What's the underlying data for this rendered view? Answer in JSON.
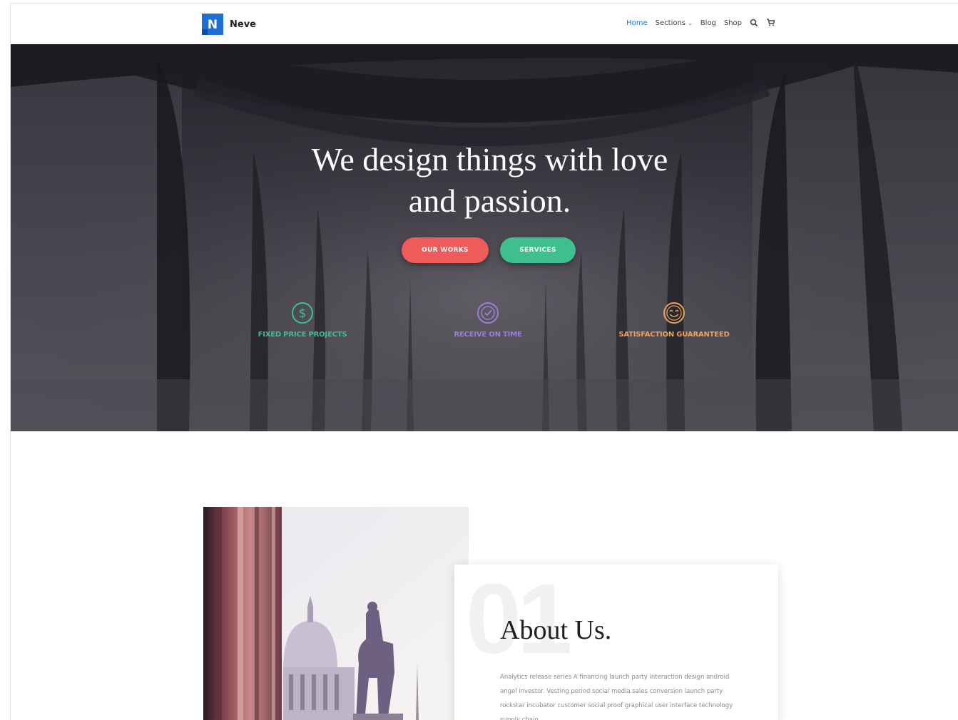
{
  "header": {
    "logo_letter": "N",
    "brand": "Neve",
    "nav": [
      {
        "label": "Home",
        "active": true
      },
      {
        "label": "Sections",
        "dropdown": true
      },
      {
        "label": "Blog"
      },
      {
        "label": "Shop"
      }
    ],
    "icons": [
      "search-icon",
      "cart-icon"
    ]
  },
  "hero": {
    "title_line1": "We design things with love",
    "title_line2": "and passion.",
    "buttons": {
      "primary": "OUR WORKS",
      "secondary": "SERVICES"
    },
    "features": [
      {
        "icon": "dollar-icon",
        "label": "FIXED PRICE PROJECTS",
        "color": "#3fbf8f"
      },
      {
        "icon": "clock-icon",
        "label": "RECEIVE ON TIME",
        "color": "#9a7fd8"
      },
      {
        "icon": "smiley-icon",
        "label": "SATISFACTION GUARANTEED",
        "color": "#e9a25b"
      }
    ]
  },
  "about": {
    "number": "01",
    "title": "About Us.",
    "text": "Analytics release series A financing launch party interaction design android angel investor. Vesting period social media sales conversion launch party rockstar incubator customer social proof graphical user interface technology supply chain."
  },
  "colors": {
    "brand_blue": "#1e6fd0",
    "button_red": "#ef5a5a",
    "button_green": "#3fbf8f"
  }
}
